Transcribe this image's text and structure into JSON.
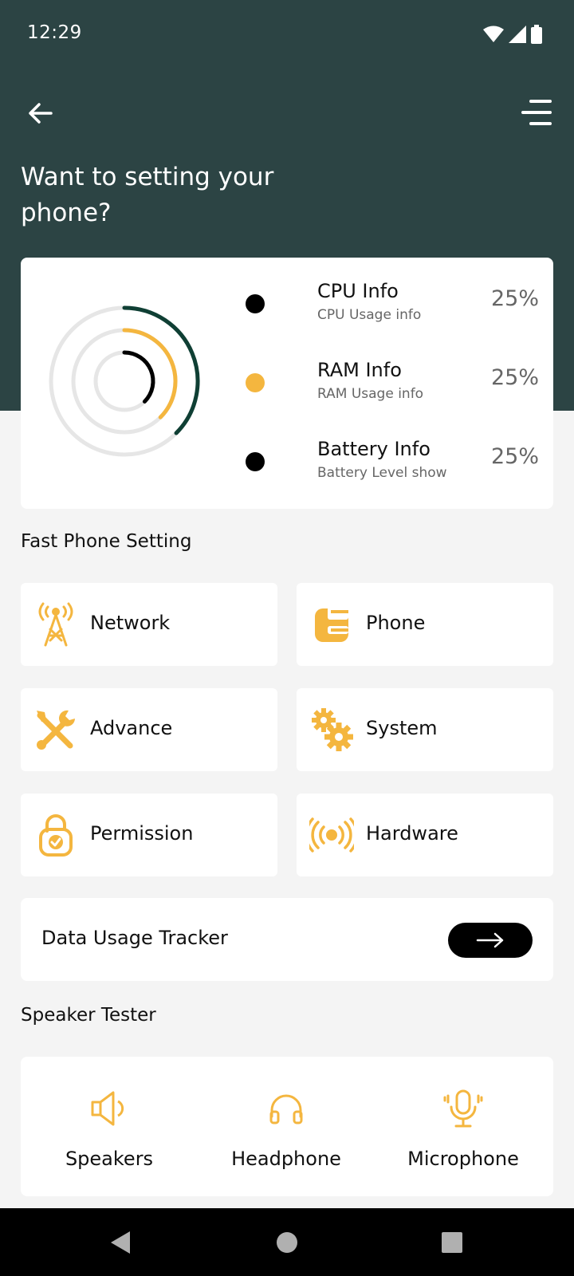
{
  "status_bar": {
    "time": "12:29"
  },
  "header": {
    "title": "Want to setting your phone?"
  },
  "stats": {
    "rings": [
      {
        "name": "CPU",
        "fraction": 0.375,
        "color": "#0f3f34"
      },
      {
        "name": "RAM",
        "fraction": 0.375,
        "color": "#f4b63f"
      },
      {
        "name": "Battery",
        "fraction": 0.375,
        "color": "#000000"
      }
    ],
    "items": [
      {
        "title": "CPU Info",
        "subtitle": "CPU Usage info",
        "value": "25%",
        "dot_color": "#000000"
      },
      {
        "title": "RAM Info",
        "subtitle": "RAM Usage info",
        "value": "25%",
        "dot_color": "#f4b63f"
      },
      {
        "title": "Battery Info",
        "subtitle": "Battery Level show",
        "value": "25%",
        "dot_color": "#000000"
      }
    ]
  },
  "fast_setting": {
    "title": "Fast Phone Setting",
    "tiles": [
      {
        "label": "Network",
        "icon": "network-tower-icon"
      },
      {
        "label": "Phone",
        "icon": "phone-card-icon"
      },
      {
        "label": "Advance",
        "icon": "tools-icon"
      },
      {
        "label": "System",
        "icon": "gears-icon"
      },
      {
        "label": "Permission",
        "icon": "lock-check-icon"
      },
      {
        "label": "Hardware",
        "icon": "broadcast-icon"
      }
    ]
  },
  "tracker": {
    "label": "Data Usage Tracker",
    "button_icon": "arrow-right-icon"
  },
  "speaker_tester": {
    "title": "Speaker Tester",
    "items": [
      {
        "label": "Speakers",
        "icon": "speaker-icon"
      },
      {
        "label": "Headphone",
        "icon": "headphone-icon"
      },
      {
        "label": "Microphone",
        "icon": "microphone-icon"
      }
    ]
  },
  "colors": {
    "header": "#2c4444",
    "accent": "#f4b63f",
    "dark_green": "#0f3f34",
    "background": "#f4f4f4"
  }
}
